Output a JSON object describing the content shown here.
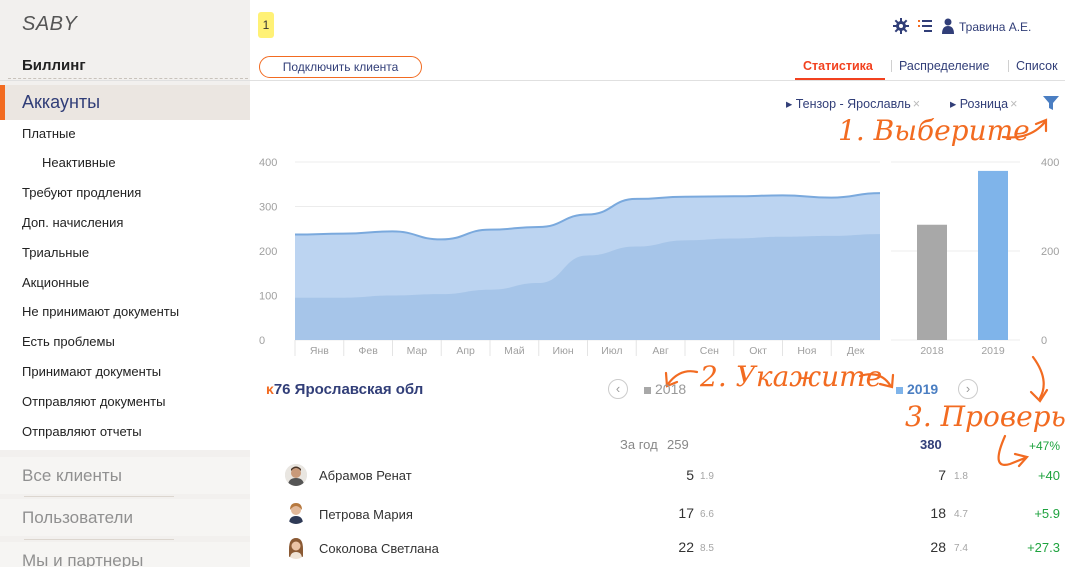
{
  "app": {
    "logo": "SABY"
  },
  "sidebar": {
    "section_title": "Биллинг",
    "accounts_title": "Аккаунты",
    "items": [
      {
        "label": "Платные"
      },
      {
        "label": "Неактивные"
      },
      {
        "label": "Требуют продления"
      },
      {
        "label": "Доп. начисления"
      },
      {
        "label": "Триальные"
      },
      {
        "label": "Акционные"
      },
      {
        "label": "Не принимают документы"
      },
      {
        "label": "Есть проблемы"
      },
      {
        "label": "Принимают документы"
      },
      {
        "label": "Отправляют документы"
      },
      {
        "label": "Отправляют отчеты"
      }
    ],
    "groups": [
      {
        "label": "Все клиенты"
      },
      {
        "label": "Пользователи"
      },
      {
        "label": "Мы и партнеры"
      }
    ]
  },
  "header": {
    "badge": "1",
    "user_name": "Травина А.Е.",
    "connect_button": "Подключить клиента",
    "tabs": [
      {
        "label": "Статистика"
      },
      {
        "label": "Распределение"
      },
      {
        "label": "Список"
      }
    ]
  },
  "filters": {
    "items": [
      {
        "label": "▸ Тензор - Ярославль"
      },
      {
        "label": "▸ Розница"
      }
    ],
    "remove": "×"
  },
  "annotations": {
    "step1": "1. Выберите",
    "step2": "2. Укажите",
    "step3": "3. Проверьте"
  },
  "colors": {
    "accent": "#f26b21",
    "active_tab": "#f2411f",
    "area_light": "#bcd4f1",
    "area_dark": "#9fc0e6",
    "line": "#7aa9dd",
    "bar_2018": "#a8a8a8",
    "bar_2019": "#7fb4ea",
    "positive": "#1fa33f"
  },
  "chart_data": [
    {
      "type": "area",
      "categories": [
        "Янв",
        "Фев",
        "Мар",
        "Апр",
        "Май",
        "Июн",
        "Июл",
        "Авг",
        "Сен",
        "Окт",
        "Ноя",
        "Дек"
      ],
      "ylim": [
        0,
        400
      ],
      "yticks": [
        "400",
        "300",
        "200",
        "100",
        "0"
      ],
      "series": [
        {
          "values": [
            237,
            239,
            244,
            226,
            248,
            254,
            282,
            317,
            322,
            323,
            325,
            320,
            330
          ]
        },
        {
          "values": [
            95,
            95,
            100,
            103,
            113,
            128,
            190,
            210,
            224,
            228,
            232,
            234,
            238
          ]
        }
      ]
    },
    {
      "type": "bar",
      "categories": [
        "2018",
        "2019"
      ],
      "values": [
        259,
        380
      ],
      "ylim": [
        0,
        400
      ],
      "yticks": [
        "400",
        "200",
        "0"
      ]
    }
  ],
  "region": {
    "back_icon": "ᴋ",
    "label": "76 Ярославская обл"
  },
  "years": {
    "prev": "2018",
    "next": "2019",
    "prev_arrow": "‹",
    "next_arrow": "›"
  },
  "table": {
    "totals": {
      "label": "За год",
      "val_2018": "259",
      "val_2019": "380",
      "delta": "+47%"
    },
    "rows": [
      {
        "name": "Абрамов Ренат",
        "v2018": "5",
        "s2018": "1.9",
        "v2019": "7",
        "s2019": "1.8",
        "delta": "+40"
      },
      {
        "name": "Петрова Мария",
        "v2018": "17",
        "s2018": "6.6",
        "v2019": "18",
        "s2019": "4.7",
        "delta": "+5.9"
      },
      {
        "name": "Соколова Светлана",
        "v2018": "22",
        "s2018": "8.5",
        "v2019": "28",
        "s2019": "7.4",
        "delta": "+27.3"
      }
    ]
  }
}
